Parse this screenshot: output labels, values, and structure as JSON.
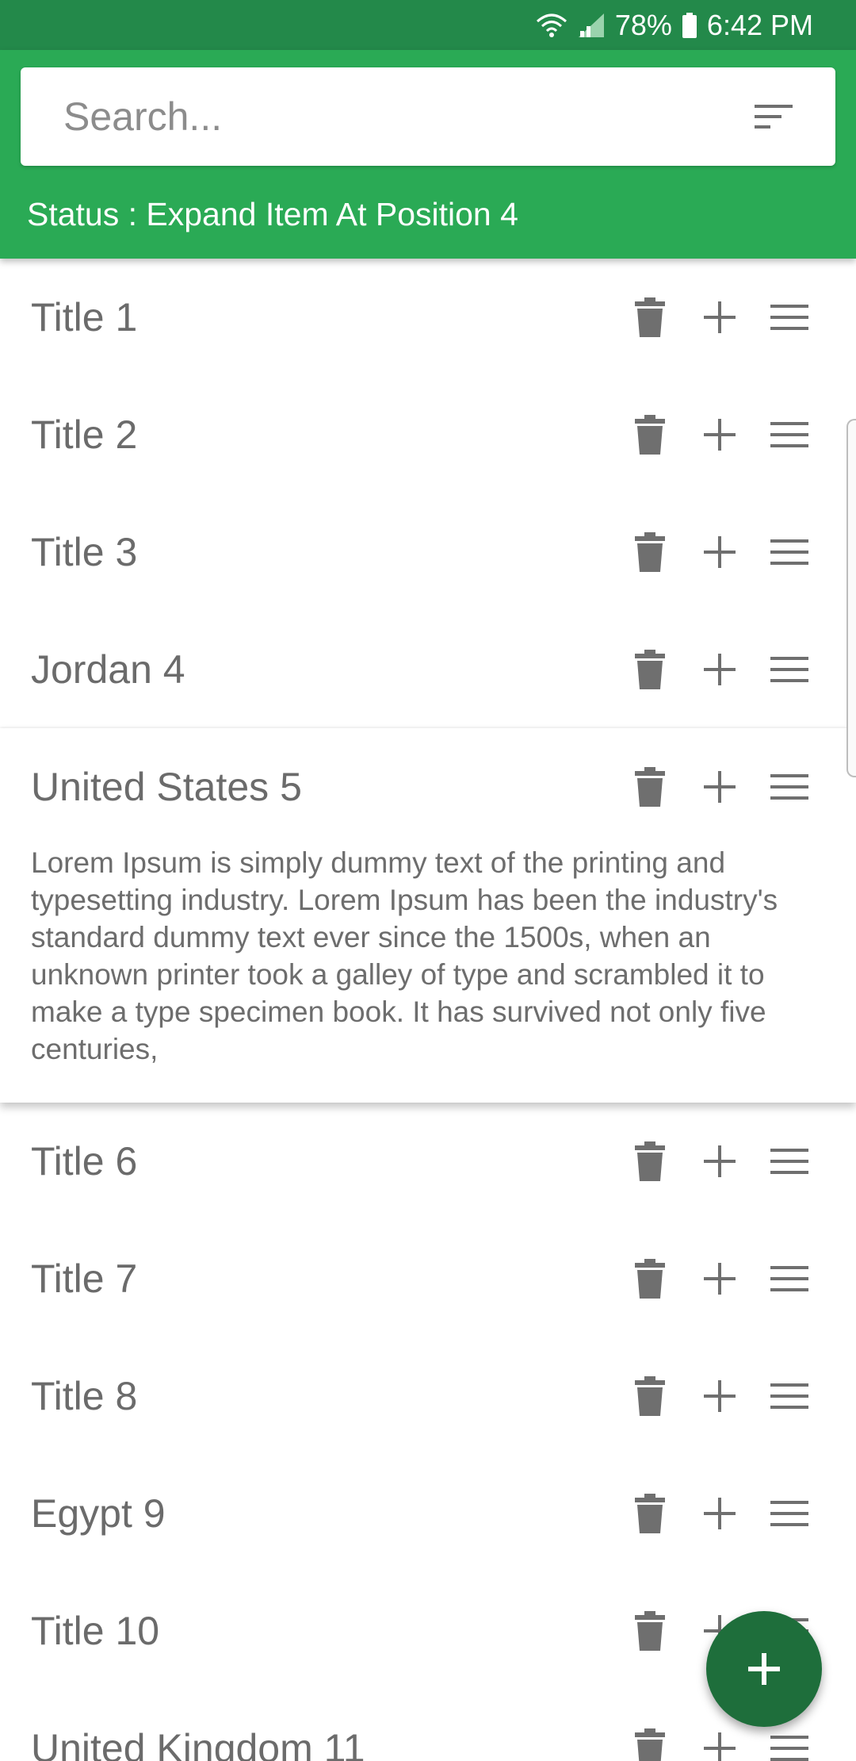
{
  "status_bar": {
    "battery": "78%",
    "time": "6:42 PM"
  },
  "search": {
    "placeholder": "Search..."
  },
  "status_text": "Status : Expand Item At Position 4",
  "items": [
    {
      "title": "Title 1"
    },
    {
      "title": "Title 2"
    },
    {
      "title": "Title 3"
    },
    {
      "title": "Jordan 4"
    },
    {
      "title": "United States 5",
      "expanded": true,
      "description": "Lorem Ipsum is simply dummy text of the printing and typesetting industry. Lorem Ipsum has been the industry's standard dummy text ever since the 1500s, when an unknown printer took a galley of type and scrambled it to make a type specimen book. It has survived not only five centuries,"
    },
    {
      "title": "Title 6"
    },
    {
      "title": "Title 7"
    },
    {
      "title": "Title 8"
    },
    {
      "title": "Egypt 9"
    },
    {
      "title": "Title 10"
    },
    {
      "title": "United Kingdom 11"
    }
  ],
  "colors": {
    "status_bar": "#23894a",
    "header": "#2aaa55",
    "fab": "#1e6e3b",
    "icon": "#6f6f6f"
  },
  "icons": {
    "row_actions": [
      "trash-icon",
      "plus-icon",
      "drag-handle-icon"
    ],
    "filter": "sort-filter-icon",
    "fab": "add-icon"
  }
}
